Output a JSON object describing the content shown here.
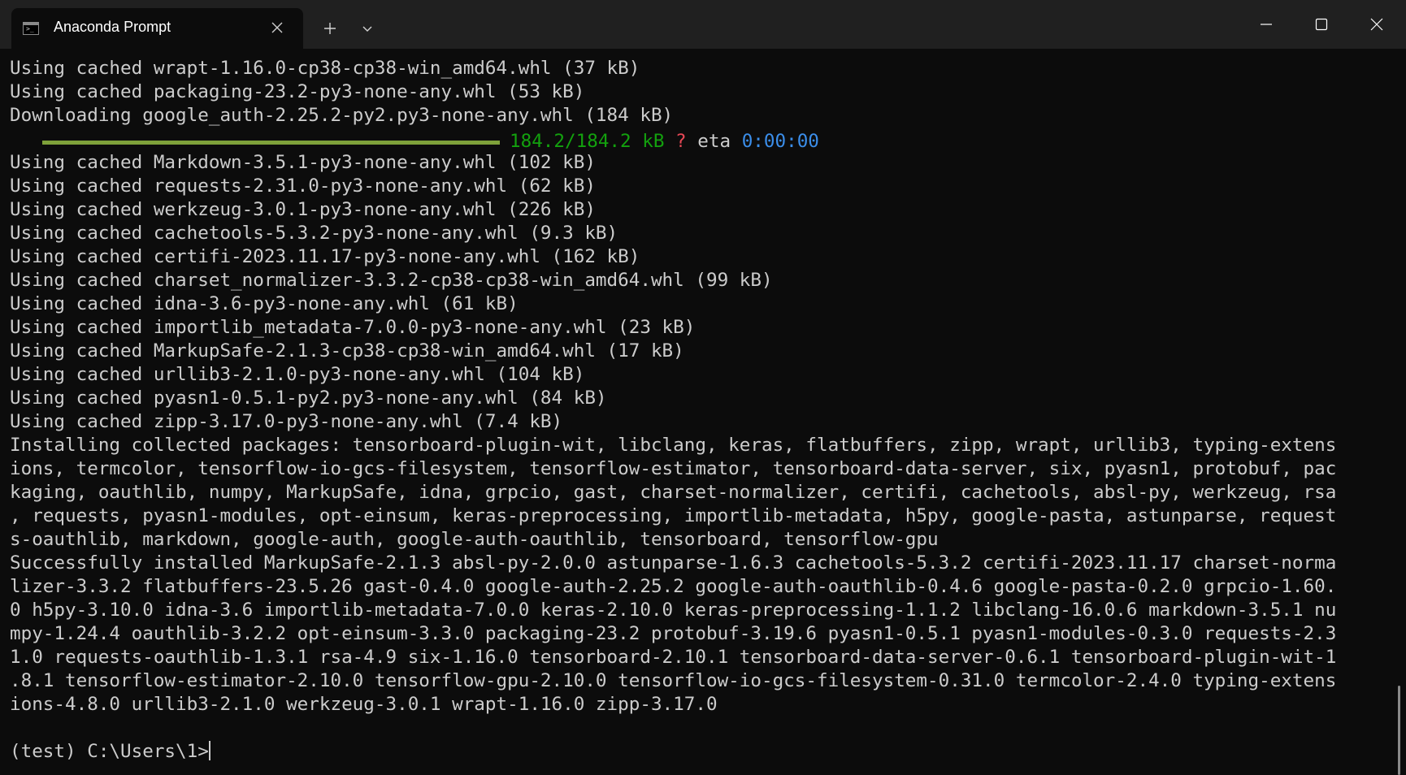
{
  "window": {
    "tab_title": "Anaconda Prompt",
    "tab_icon": "terminal-icon",
    "tab_icon_glyph": ">_",
    "tab_close_icon": "close-icon",
    "new_tab_icon": "plus-icon",
    "dropdown_icon": "chevron-down-icon",
    "controls": {
      "minimize_icon": "minimize-icon",
      "maximize_icon": "maximize-icon",
      "close_icon": "close-icon"
    }
  },
  "terminal": {
    "lines_top": [
      "Using cached wrapt-1.16.0-cp38-cp38-win_amd64.whl (37 kB)",
      "Using cached packaging-23.2-py3-none-any.whl (53 kB)",
      "Downloading google_auth-2.25.2-py2.py3-none-any.whl (184 kB)"
    ],
    "progress": {
      "fraction": 1.0,
      "size": "184.2/184.2 kB",
      "unknown": "?",
      "eta_label": "eta",
      "eta": "0:00:00"
    },
    "lines_bottom": [
      "Using cached Markdown-3.5.1-py3-none-any.whl (102 kB)",
      "Using cached requests-2.31.0-py3-none-any.whl (62 kB)",
      "Using cached werkzeug-3.0.1-py3-none-any.whl (226 kB)",
      "Using cached cachetools-5.3.2-py3-none-any.whl (9.3 kB)",
      "Using cached certifi-2023.11.17-py3-none-any.whl (162 kB)",
      "Using cached charset_normalizer-3.3.2-cp38-cp38-win_amd64.whl (99 kB)",
      "Using cached idna-3.6-py3-none-any.whl (61 kB)",
      "Using cached importlib_metadata-7.0.0-py3-none-any.whl (23 kB)",
      "Using cached MarkupSafe-2.1.3-cp38-cp38-win_amd64.whl (17 kB)",
      "Using cached urllib3-2.1.0-py3-none-any.whl (104 kB)",
      "Using cached pyasn1-0.5.1-py2.py3-none-any.whl (84 kB)",
      "Using cached zipp-3.17.0-py3-none-any.whl (7.4 kB)",
      "Installing collected packages: tensorboard-plugin-wit, libclang, keras, flatbuffers, zipp, wrapt, urllib3, typing-extens",
      "ions, termcolor, tensorflow-io-gcs-filesystem, tensorflow-estimator, tensorboard-data-server, six, pyasn1, protobuf, pac",
      "kaging, oauthlib, numpy, MarkupSafe, idna, grpcio, gast, charset-normalizer, certifi, cachetools, absl-py, werkzeug, rsa",
      ", requests, pyasn1-modules, opt-einsum, keras-preprocessing, importlib-metadata, h5py, google-pasta, astunparse, request",
      "s-oauthlib, markdown, google-auth, google-auth-oauthlib, tensorboard, tensorflow-gpu",
      "Successfully installed MarkupSafe-2.1.3 absl-py-2.0.0 astunparse-1.6.3 cachetools-5.3.2 certifi-2023.11.17 charset-norma",
      "lizer-3.3.2 flatbuffers-23.5.26 gast-0.4.0 google-auth-2.25.2 google-auth-oauthlib-0.4.6 google-pasta-0.2.0 grpcio-1.60.",
      "0 h5py-3.10.0 idna-3.6 importlib-metadata-7.0.0 keras-2.10.0 keras-preprocessing-1.1.2 libclang-16.0.6 markdown-3.5.1 nu",
      "mpy-1.24.4 oauthlib-3.2.2 opt-einsum-3.3.0 packaging-23.2 protobuf-3.19.6 pyasn1-0.5.1 pyasn1-modules-0.3.0 requests-2.3",
      "1.0 requests-oauthlib-1.3.1 rsa-4.9 six-1.16.0 tensorboard-2.10.1 tensorboard-data-server-0.6.1 tensorboard-plugin-wit-1",
      ".8.1 tensorflow-estimator-2.10.0 tensorflow-gpu-2.10.0 tensorflow-io-gcs-filesystem-0.31.0 termcolor-2.4.0 typing-extens",
      "ions-4.8.0 urllib3-2.1.0 werkzeug-3.0.1 wrapt-1.16.0 zipp-3.17.0"
    ],
    "prompt": "(test) C:\\Users\\1>"
  },
  "colors": {
    "background": "#0c0c0c",
    "titlebar": "#202020",
    "text": "#cccccc",
    "progress_bar": "#7ea13a",
    "progress_size": "#13a10e",
    "progress_unknown": "#e74856",
    "progress_eta": "#3b8eea"
  }
}
